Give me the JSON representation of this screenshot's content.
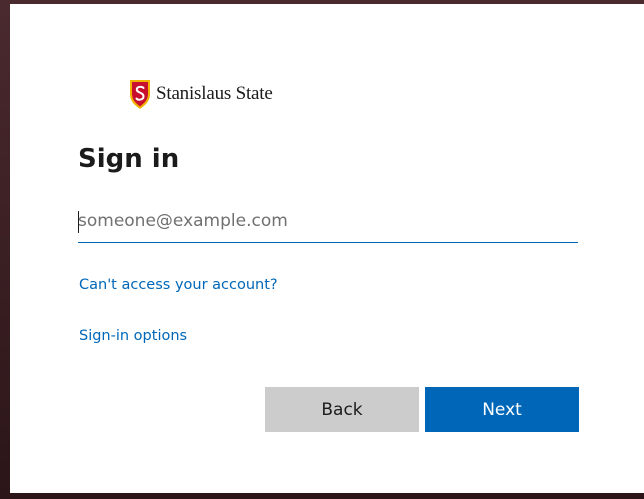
{
  "logo": {
    "text": "Stanislaus State"
  },
  "page_title": "Sign in",
  "email": {
    "value": "",
    "placeholder": "someone@example.com"
  },
  "links": {
    "cant_access": "Can't access your account?",
    "signin_options": "Sign-in options"
  },
  "buttons": {
    "back": "Back",
    "next": "Next"
  },
  "colors": {
    "accent": "#0067b8",
    "back_button": "#cccccc",
    "shield_red": "#c8102e",
    "shield_gold": "#f2b300"
  }
}
